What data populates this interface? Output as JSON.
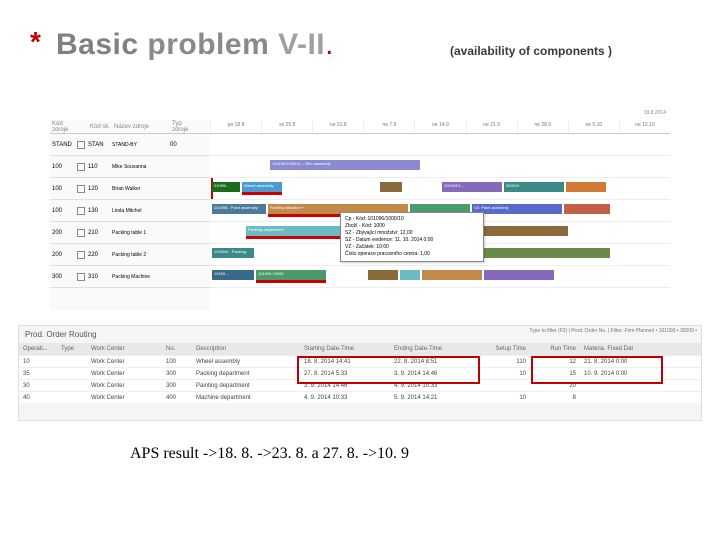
{
  "title": {
    "bullet": "*",
    "w1": "Basic",
    "w2": "problem",
    "suffix": " V-II",
    "dot": "."
  },
  "subtitle": "(availability of components )",
  "viz": {
    "cols": [
      "Kód zdroje",
      "Kód sk.",
      "Název zdroje",
      "Typ zdroje"
    ],
    "rows": [
      {
        "code": "STAND",
        "grp": "STAN",
        "name": "STAND-BY",
        "type": "00"
      },
      {
        "code": "100",
        "grp": "110",
        "name": "Mike Souvanna",
        "type": ""
      },
      {
        "code": "100",
        "grp": "120",
        "name": "Brian Walker",
        "type": ""
      },
      {
        "code": "100",
        "grp": "130",
        "name": "Linda Mitchel",
        "type": ""
      },
      {
        "code": "200",
        "grp": "210",
        "name": "Packing table 1",
        "type": ""
      },
      {
        "code": "200",
        "grp": "220",
        "name": "Packing table 2",
        "type": ""
      },
      {
        "code": "300",
        "grp": "310",
        "name": "Packing Machine",
        "type": ""
      }
    ],
    "datemark": "19.8.2014",
    "ticks": [
      "po 18.8",
      "so 25.8",
      "ne 31.8",
      "ne 7.9",
      "ne 14.9",
      "ne 21.9",
      "ne 28.9",
      "ne 5.10",
      "ne 12.10"
    ],
    "tooltip": [
      "Cp - Kód: 101096/1000/10",
      "Zboží - Kód: 1000",
      "SZ - Zbývající množství: 12,00",
      "SZ - Datum evidence: 11. 10. 2014 0:00",
      "VZ - Začátek: 10:00",
      "Číslo operace pracovního centra: 1,00"
    ]
  },
  "routing": {
    "title": "Prod. Order Routing",
    "filter": "Type to filter (F3) | Prod. Order No. | Filter: Firm Planned • 101099 • 30000 • ",
    "head": [
      "Operati...",
      "Type",
      "Work Center",
      "No.",
      "Description",
      "Starting Date-Time",
      "Ending Date-Time",
      "Setup Time",
      "Run Time",
      "Materia. Fixed Dat"
    ],
    "rows": [
      {
        "op": "10",
        "type": "",
        "wc": "Work Center",
        "no": "100",
        "desc": "Wheel assembly",
        "start": "18. 8. 2014 14:41",
        "end": "22. 8. 2014 8:51",
        "setup": "110",
        "run": "12",
        "mat": "21. 8. 2014 0:00"
      },
      {
        "op": "35",
        "type": "",
        "wc": "Work Center",
        "no": "300",
        "desc": "Packing department",
        "start": "27. 8. 2014 5:33",
        "end": "3. 9. 2014 14:46",
        "setup": "10",
        "run": "15",
        "mat": "10. 9. 2014 0:00"
      },
      {
        "op": "30",
        "type": "",
        "wc": "Work Center",
        "no": "300",
        "desc": "Painting department",
        "start": "3. 9. 2014 14:46",
        "end": "4. 9. 2014 10:33",
        "setup": "",
        "run": "20",
        "mat": ""
      },
      {
        "op": "40",
        "type": "",
        "wc": "Work Center",
        "no": "400",
        "desc": "Machine department",
        "start": "4. 9. 2014 10:33",
        "end": "5. 9. 2014 14:21",
        "setup": "10",
        "run": "8",
        "mat": ""
      }
    ]
  },
  "aps": "APS result ->18. 8. ->23. 8. a 27. 8. ->10. 9"
}
